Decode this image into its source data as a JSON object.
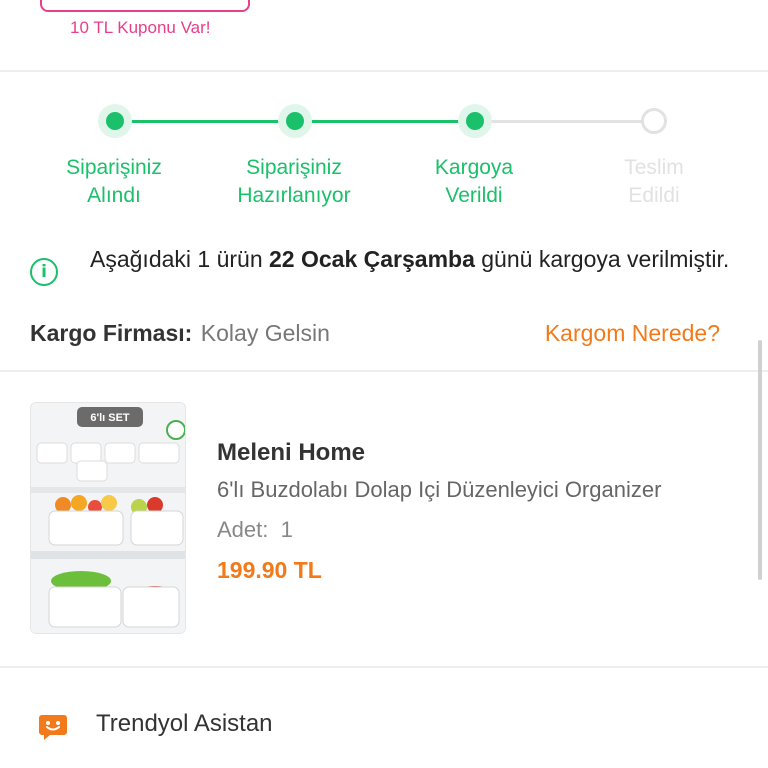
{
  "coupon": {
    "text": "10 TL Kuponu Var!"
  },
  "stepper": {
    "steps": [
      {
        "line1": "Siparişiniz",
        "line2": "Alındı",
        "state": "done"
      },
      {
        "line1": "Siparişiniz",
        "line2": "Hazırlanıyor",
        "state": "done"
      },
      {
        "line1": "Kargoya",
        "line2": "Verildi",
        "state": "done"
      },
      {
        "line1": "Teslim",
        "line2": "Edildi",
        "state": "todo"
      }
    ],
    "active_color": "#1bc06a",
    "inactive_color": "#e2e2e2"
  },
  "info": {
    "icon": "info-circle-icon",
    "prefix": "Aşağıdaki 1 ürün ",
    "date": "22 Ocak Çarşamba",
    "suffix": " günü kargoya verilmiştir."
  },
  "shipment": {
    "carrier_label": "Kargo Firması:",
    "carrier_value": "Kolay Gelsin",
    "track_link": "Kargom Nerede?"
  },
  "product": {
    "image_badge": "6'lı SET",
    "brand": "Meleni Home",
    "name": "6'lı Buzdolabı Dolap Içi Düzenleyici Organizer",
    "qty_label": "Adet:",
    "qty_value": "1",
    "price": "199.90 TL"
  },
  "assistant": {
    "icon": "chat-bot-icon",
    "label": "Trendyol Asistan"
  },
  "colors": {
    "accent_orange": "#f27a1a",
    "accent_pink": "#e83e8c",
    "success_green": "#1bc06a"
  }
}
